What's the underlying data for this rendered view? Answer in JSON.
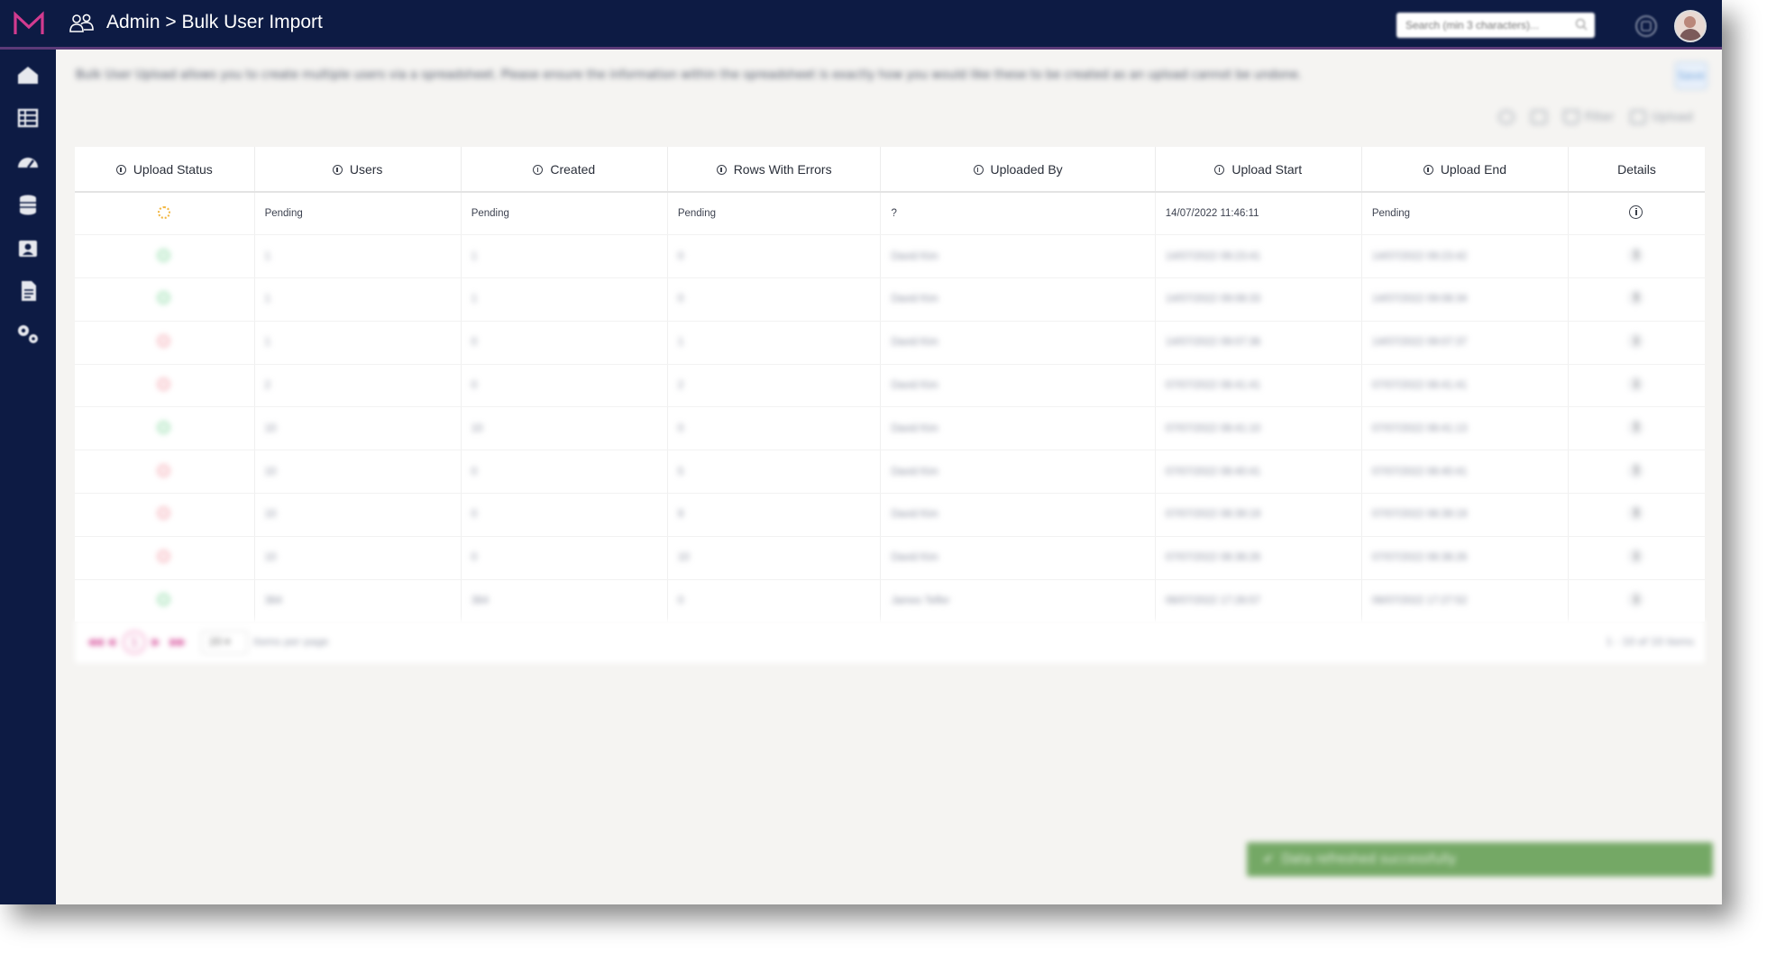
{
  "header": {
    "title": "Admin > Bulk User Import",
    "search_placeholder": "Search (min 3 characters)..."
  },
  "sidebar": {
    "items": [
      {
        "icon": "home-icon"
      },
      {
        "icon": "grid-icon"
      },
      {
        "icon": "dashboard-gauge-icon"
      },
      {
        "icon": "database-icon"
      },
      {
        "icon": "folder-user-icon"
      },
      {
        "icon": "document-icon"
      },
      {
        "icon": "settings-gears-icon"
      }
    ]
  },
  "main": {
    "description": "Bulk User Upload allows you to create multiple users via a spreadsheet. Please ensure the information within the spreadsheet is exactly how you would like these to be created as an upload cannot be undone.",
    "save_label": "Save",
    "toolbar": {
      "filter_label": "Filter",
      "upload_label": "Upload"
    }
  },
  "table": {
    "columns": [
      "Upload Status",
      "Users",
      "Created",
      "Rows With Errors",
      "Uploaded By",
      "Upload Start",
      "Upload End",
      "Details"
    ],
    "rows": [
      {
        "status": "pending",
        "users": "Pending",
        "created": "Pending",
        "errors": "Pending",
        "uploaded_by": "?",
        "start": "14/07/2022 11:46:11",
        "end": "Pending"
      },
      {
        "status": "success",
        "users": "1",
        "created": "1",
        "errors": "0",
        "uploaded_by": "David Kim",
        "start": "14/07/2022 09:23:41",
        "end": "14/07/2022 09:23:42"
      },
      {
        "status": "success",
        "users": "1",
        "created": "1",
        "errors": "0",
        "uploaded_by": "David Kim",
        "start": "14/07/2022 09:08:33",
        "end": "14/07/2022 09:08:34"
      },
      {
        "status": "error",
        "users": "1",
        "created": "0",
        "errors": "1",
        "uploaded_by": "David Kim",
        "start": "14/07/2022 09:07:36",
        "end": "14/07/2022 09:07:37"
      },
      {
        "status": "error",
        "users": "2",
        "created": "0",
        "errors": "2",
        "uploaded_by": "David Kim",
        "start": "07/07/2022 08:41:41",
        "end": "07/07/2022 08:41:41"
      },
      {
        "status": "success",
        "users": "10",
        "created": "10",
        "errors": "0",
        "uploaded_by": "David Kim",
        "start": "07/07/2022 08:41:10",
        "end": "07/07/2022 08:41:13"
      },
      {
        "status": "error",
        "users": "10",
        "created": "0",
        "errors": "5",
        "uploaded_by": "David Kim",
        "start": "07/07/2022 08:40:41",
        "end": "07/07/2022 08:40:41"
      },
      {
        "status": "error",
        "users": "10",
        "created": "0",
        "errors": "9",
        "uploaded_by": "David Kim",
        "start": "07/07/2022 08:39:19",
        "end": "07/07/2022 08:39:19"
      },
      {
        "status": "error",
        "users": "10",
        "created": "0",
        "errors": "10",
        "uploaded_by": "David Kim",
        "start": "07/07/2022 08:38:26",
        "end": "07/07/2022 08:38:26"
      },
      {
        "status": "success",
        "users": "364",
        "created": "364",
        "errors": "0",
        "uploaded_by": "James Telfer",
        "start": "06/07/2022 17:26:57",
        "end": "06/07/2022 17:27:52"
      }
    ]
  },
  "pagination": {
    "current_page": "1",
    "page_size": "20",
    "items_per_page_label": "items per page",
    "count_text": "1 - 10 of 10 items"
  },
  "toast": {
    "message": "Data refreshed successfully"
  },
  "colors": {
    "topbar": "#0d1b44",
    "brand_accent": "#d23b8f",
    "success": "#7ed69a",
    "error": "#f29aa5",
    "pending": "#f2b640",
    "toast_bg": "#74a865"
  }
}
